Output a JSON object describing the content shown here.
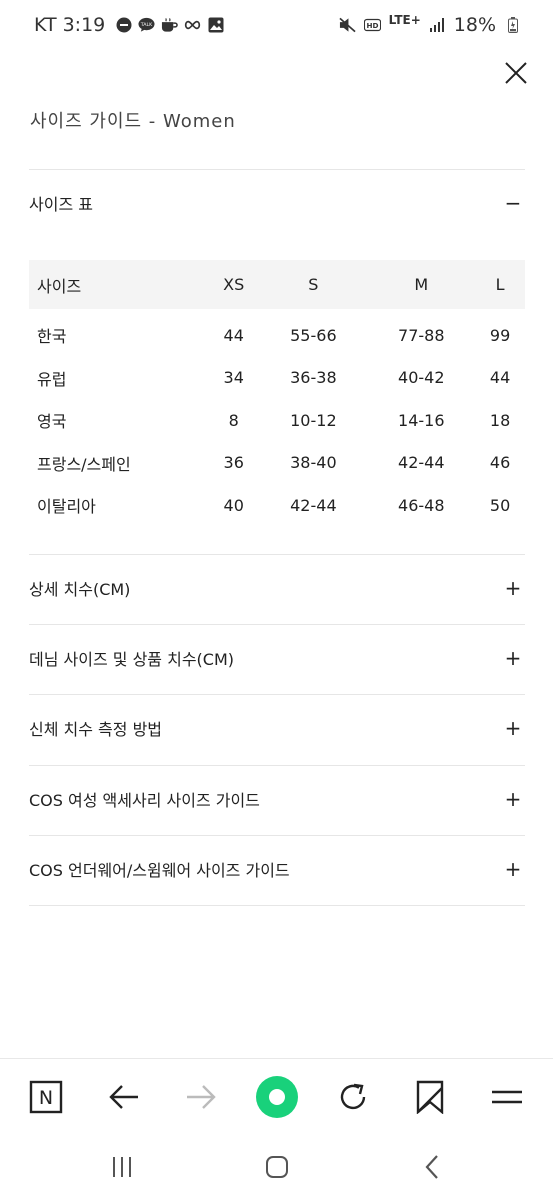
{
  "status_bar": {
    "carrier": "KT",
    "time": "3:19",
    "network": "LTE+",
    "battery": "18%"
  },
  "page": {
    "title": "사이즈 가이드 - Women"
  },
  "size_section": {
    "label": "사이즈 표",
    "toggle": "−",
    "table": {
      "headers": [
        "사이즈",
        "XS",
        "S",
        "M",
        "L"
      ],
      "rows": [
        [
          "한국",
          "44",
          "55-66",
          "77-88",
          "99"
        ],
        [
          "유럽",
          "34",
          "36-38",
          "40-42",
          "44"
        ],
        [
          "영국",
          "8",
          "10-12",
          "14-16",
          "18"
        ],
        [
          "프랑스/스페인",
          "36",
          "38-40",
          "42-44",
          "46"
        ],
        [
          "이탈리아",
          "40",
          "42-44",
          "46-48",
          "50"
        ]
      ]
    }
  },
  "accordions": [
    {
      "label": "상세 치수(CM)",
      "toggle": "+"
    },
    {
      "label": "데님 사이즈 및 상품 치수(CM)",
      "toggle": "+"
    },
    {
      "label": "신체 치수 측정 방법",
      "toggle": "+"
    },
    {
      "label": "COS 여성 액세사리 사이즈 가이드",
      "toggle": "+"
    },
    {
      "label": "COS 언더웨어/스윔웨어 사이즈 가이드",
      "toggle": "+"
    }
  ],
  "browser_toolbar": {
    "home_letter": "N",
    "accent_color": "#19d17b",
    "icons": [
      "naver-home-icon",
      "back-arrow-icon",
      "forward-arrow-icon",
      "green-dot-icon",
      "refresh-icon",
      "bookmark-icon",
      "menu-icon"
    ]
  },
  "system_nav": {
    "icons": [
      "recent-apps-icon",
      "home-icon",
      "back-icon"
    ]
  }
}
